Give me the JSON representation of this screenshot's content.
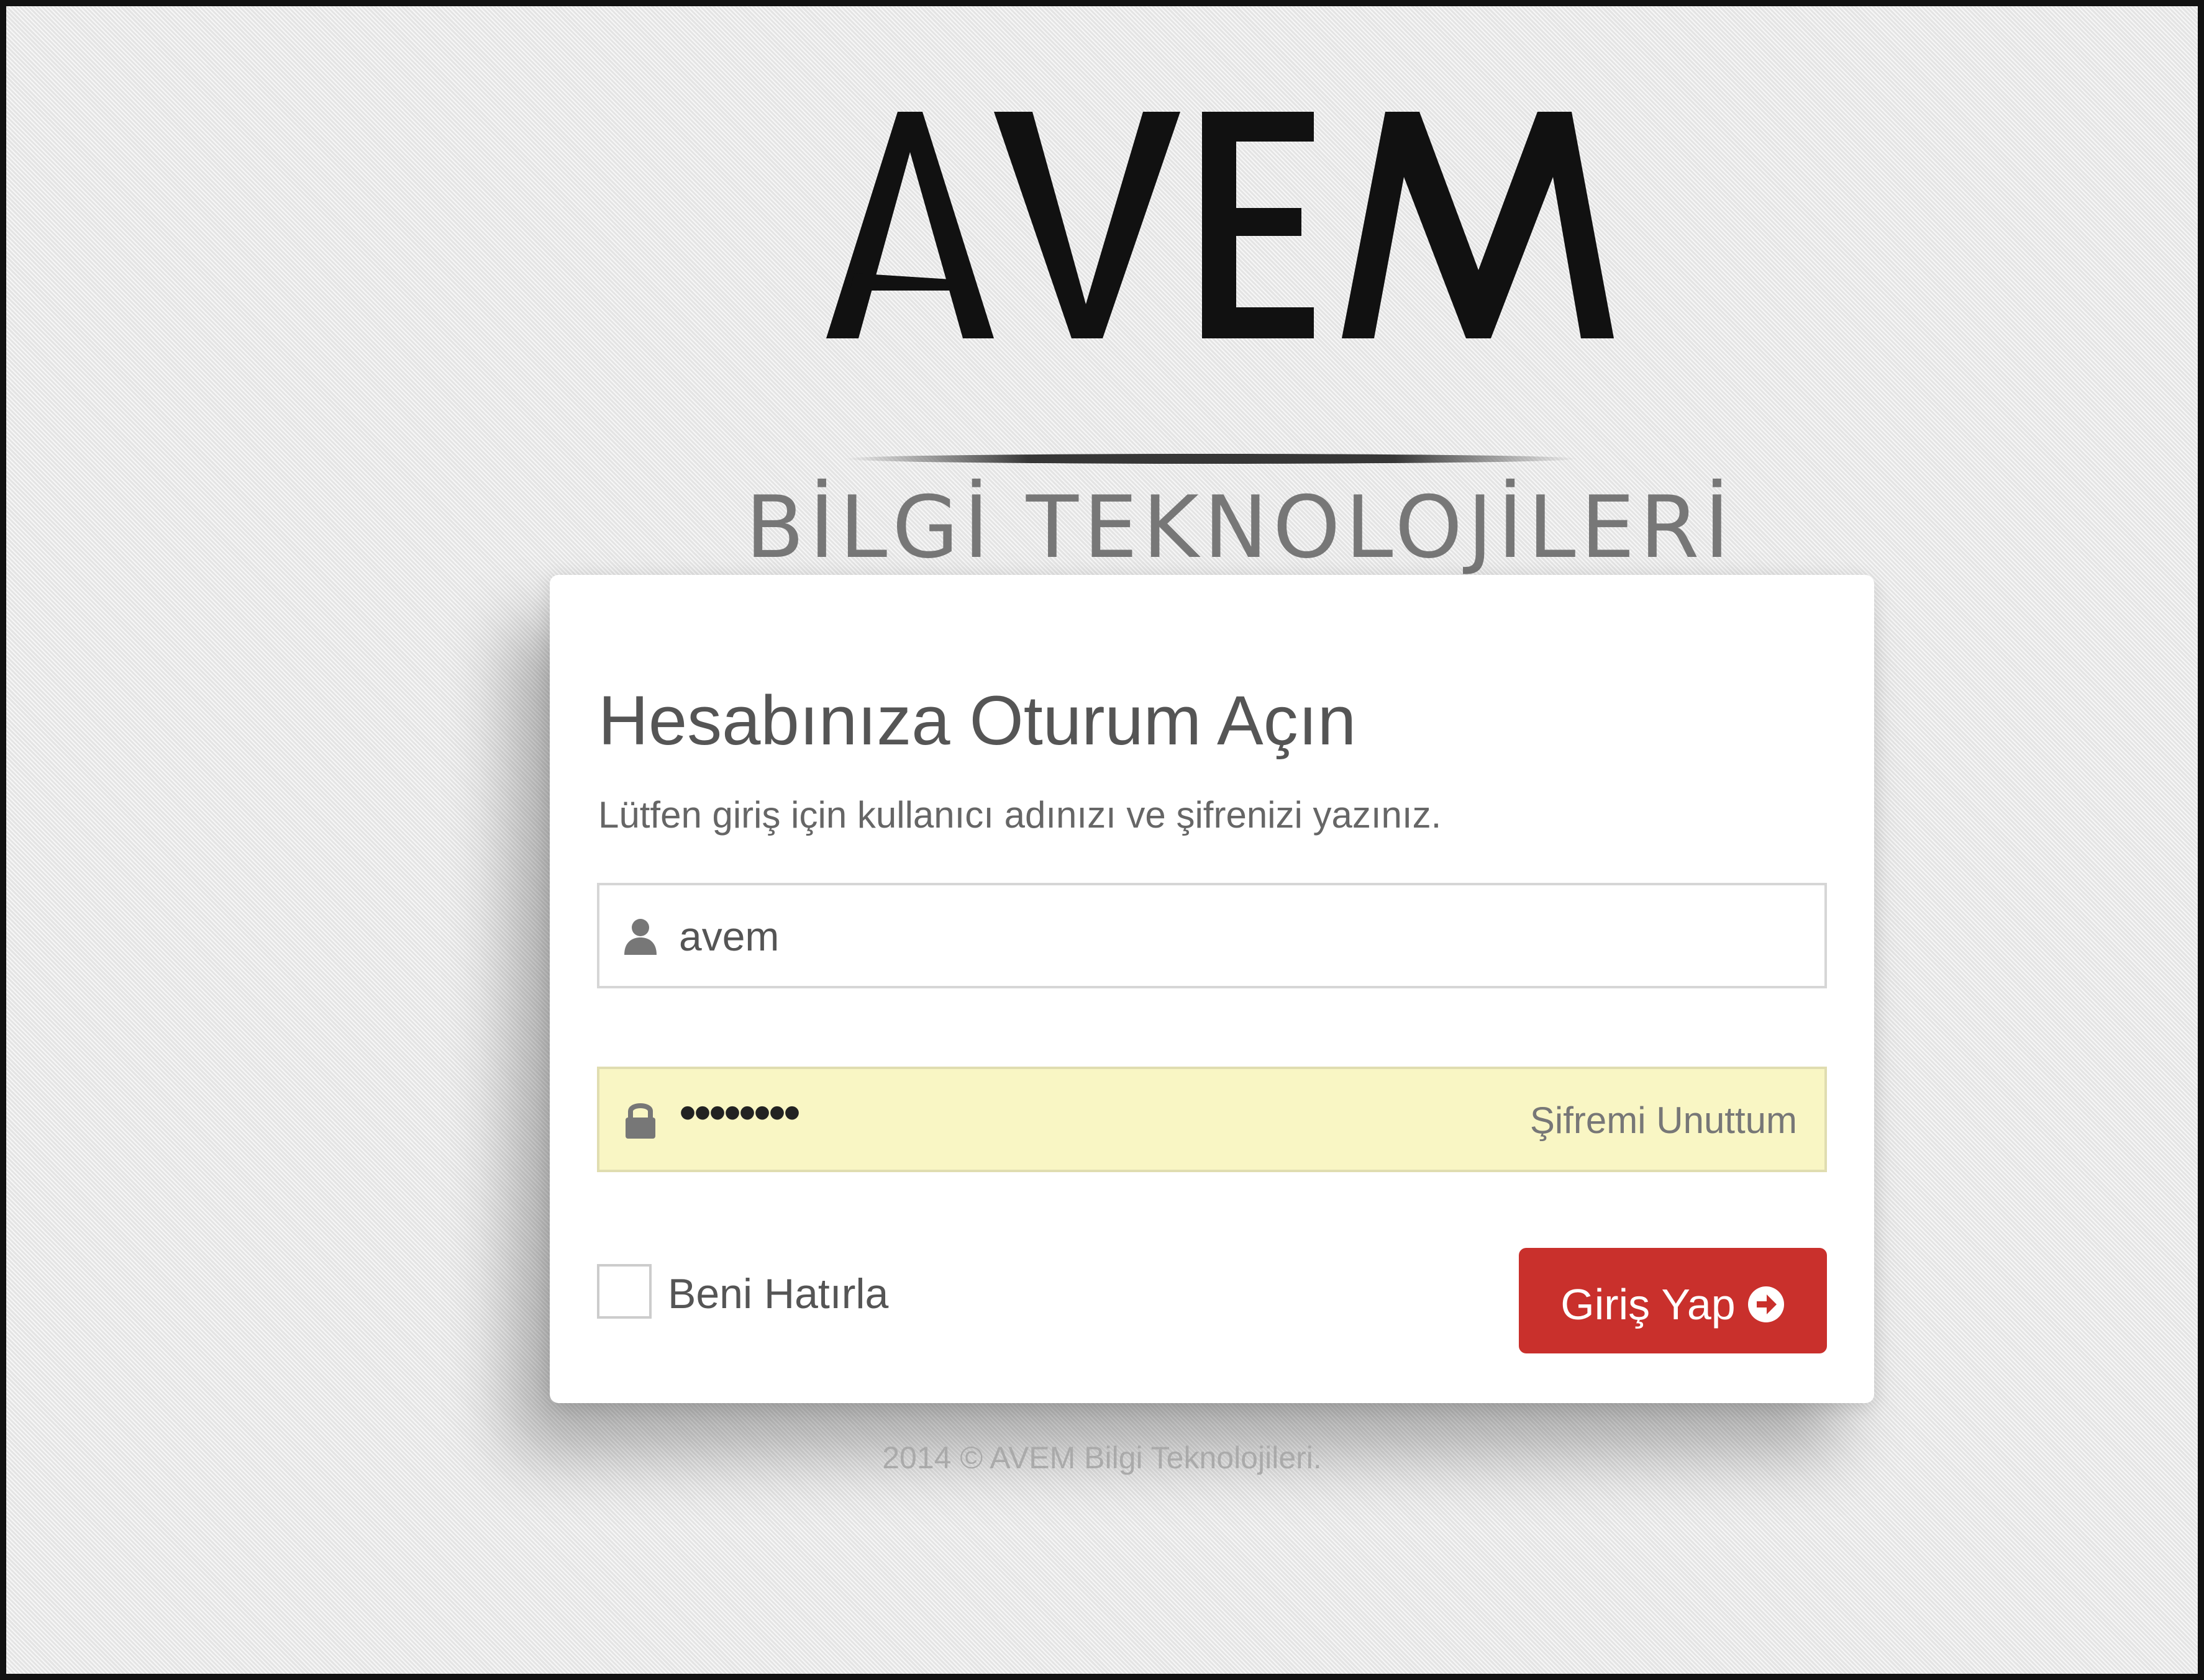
{
  "brand": {
    "logo_text": "AVEM",
    "subtitle": "BİLGİ TEKNOLOJİLERİ"
  },
  "login": {
    "title": "Hesabınıza Oturum Açın",
    "instructions": "Lütfen giriş için kullanıcı adınızı ve şifrenizi yazınız.",
    "username": {
      "value": "avem",
      "icon": "user-icon"
    },
    "password": {
      "masked_value": "••••••••",
      "icon": "lock-icon",
      "forgot_link": "Şifremi Unuttum"
    },
    "remember_me": {
      "label": "Beni Hatırla",
      "checked": false
    },
    "submit": {
      "label": "Giriş Yap",
      "icon": "arrow-circle-right-icon"
    }
  },
  "footer": {
    "copyright": "2014 © AVEM Bilgi Teknolojileri."
  },
  "colors": {
    "submit_button": "#c9302c",
    "password_field_bg": "#f9f6c4",
    "logo_black": "#111111",
    "subtitle_gray": "#777777"
  }
}
